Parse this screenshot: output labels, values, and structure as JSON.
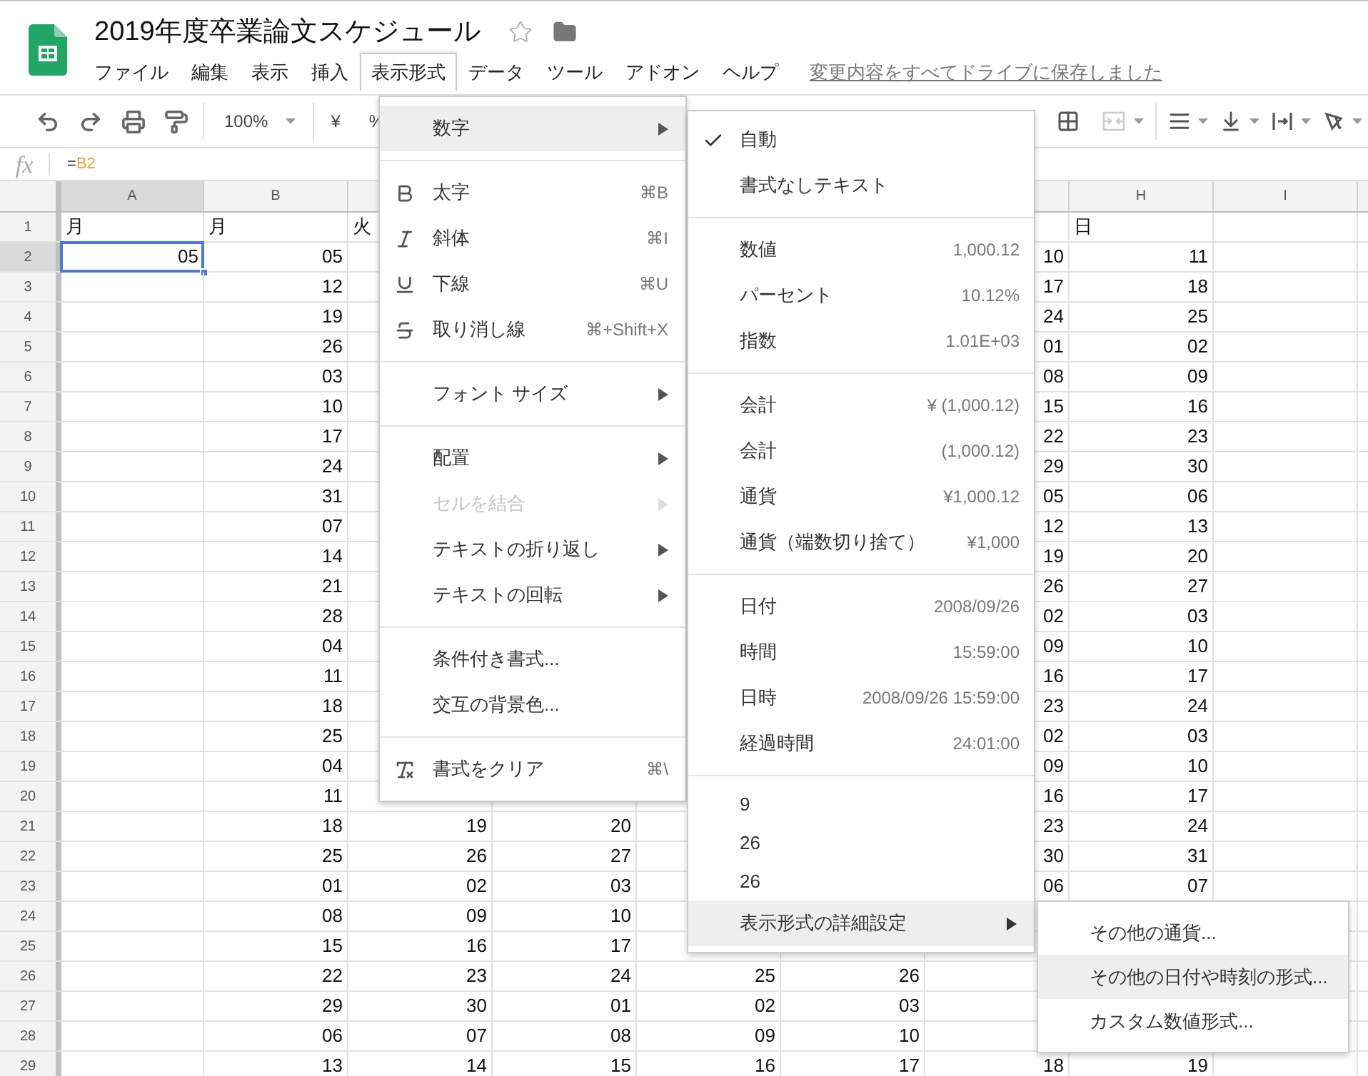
{
  "title": "2019年度卒業論文スケジュール",
  "menubar": [
    {
      "label": "ファイル",
      "selected": false
    },
    {
      "label": "編集",
      "selected": false
    },
    {
      "label": "表示",
      "selected": false
    },
    {
      "label": "挿入",
      "selected": false
    },
    {
      "label": "表示形式",
      "selected": true
    },
    {
      "label": "データ",
      "selected": false
    },
    {
      "label": "ツール",
      "selected": false
    },
    {
      "label": "アドオン",
      "selected": false
    },
    {
      "label": "ヘルプ",
      "selected": false
    }
  ],
  "save_status": "変更内容をすべてドライブに保存しました",
  "toolbar": {
    "zoom": "100%",
    "currency": "¥",
    "percent": "%"
  },
  "formula": {
    "label": "fx",
    "sign": "=",
    "reference": "B2"
  },
  "columns": [
    {
      "label": "A",
      "selected": true
    },
    {
      "label": "B",
      "selected": false
    },
    null,
    null,
    null,
    null,
    null,
    {
      "label": "H",
      "selected": false
    },
    {
      "label": "I",
      "selected": false
    }
  ],
  "rows": [
    {
      "number": "1",
      "selected": false,
      "kind": "text",
      "cells": [
        "月",
        "月",
        "火",
        null,
        null,
        null,
        null,
        "日",
        null
      ]
    },
    {
      "number": "2",
      "selected": true,
      "kind": "number",
      "cells": [
        "05",
        "05",
        null,
        null,
        null,
        null,
        "10",
        "11",
        null
      ]
    },
    {
      "number": "3",
      "selected": false,
      "kind": "number",
      "cells": [
        null,
        "12",
        null,
        null,
        null,
        null,
        "17",
        "18",
        null
      ]
    },
    {
      "number": "4",
      "selected": false,
      "kind": "number",
      "cells": [
        null,
        "19",
        null,
        null,
        null,
        null,
        "24",
        "25",
        null
      ]
    },
    {
      "number": "5",
      "selected": false,
      "kind": "number",
      "cells": [
        null,
        "26",
        null,
        null,
        null,
        null,
        "01",
        "02",
        null
      ]
    },
    {
      "number": "6",
      "selected": false,
      "kind": "number",
      "cells": [
        null,
        "03",
        null,
        null,
        null,
        null,
        "08",
        "09",
        null
      ]
    },
    {
      "number": "7",
      "selected": false,
      "kind": "number",
      "cells": [
        null,
        "10",
        null,
        null,
        null,
        null,
        "15",
        "16",
        null
      ]
    },
    {
      "number": "8",
      "selected": false,
      "kind": "number",
      "cells": [
        null,
        "17",
        null,
        null,
        null,
        null,
        "22",
        "23",
        null
      ]
    },
    {
      "number": "9",
      "selected": false,
      "kind": "number",
      "cells": [
        null,
        "24",
        null,
        null,
        null,
        null,
        "29",
        "30",
        null
      ]
    },
    {
      "number": "10",
      "selected": false,
      "kind": "number",
      "cells": [
        null,
        "31",
        null,
        null,
        null,
        null,
        "05",
        "06",
        null
      ]
    },
    {
      "number": "11",
      "selected": false,
      "kind": "number",
      "cells": [
        null,
        "07",
        null,
        null,
        null,
        null,
        "12",
        "13",
        null
      ]
    },
    {
      "number": "12",
      "selected": false,
      "kind": "number",
      "cells": [
        null,
        "14",
        null,
        null,
        null,
        null,
        "19",
        "20",
        null
      ]
    },
    {
      "number": "13",
      "selected": false,
      "kind": "number",
      "cells": [
        null,
        "21",
        null,
        null,
        null,
        null,
        "26",
        "27",
        null
      ]
    },
    {
      "number": "14",
      "selected": false,
      "kind": "number",
      "cells": [
        null,
        "28",
        null,
        null,
        null,
        null,
        "02",
        "03",
        null
      ]
    },
    {
      "number": "15",
      "selected": false,
      "kind": "number",
      "cells": [
        null,
        "04",
        null,
        null,
        null,
        null,
        "09",
        "10",
        null
      ]
    },
    {
      "number": "16",
      "selected": false,
      "kind": "number",
      "cells": [
        null,
        "11",
        null,
        null,
        null,
        null,
        "16",
        "17",
        null
      ]
    },
    {
      "number": "17",
      "selected": false,
      "kind": "number",
      "cells": [
        null,
        "18",
        null,
        null,
        null,
        null,
        "23",
        "24",
        null
      ]
    },
    {
      "number": "18",
      "selected": false,
      "kind": "number",
      "cells": [
        null,
        "25",
        null,
        null,
        null,
        null,
        "02",
        "03",
        null
      ]
    },
    {
      "number": "19",
      "selected": false,
      "kind": "number",
      "cells": [
        null,
        "04",
        null,
        null,
        null,
        null,
        "09",
        "10",
        null
      ]
    },
    {
      "number": "20",
      "selected": false,
      "kind": "number",
      "cells": [
        null,
        "11",
        null,
        null,
        null,
        null,
        "16",
        "17",
        null
      ]
    },
    {
      "number": "21",
      "selected": false,
      "kind": "number",
      "cells": [
        null,
        "18",
        "19",
        "20",
        null,
        null,
        "23",
        "24",
        null
      ]
    },
    {
      "number": "22",
      "selected": false,
      "kind": "number",
      "cells": [
        null,
        "25",
        "26",
        "27",
        null,
        null,
        "30",
        "31",
        null
      ]
    },
    {
      "number": "23",
      "selected": false,
      "kind": "number",
      "cells": [
        null,
        "01",
        "02",
        "03",
        null,
        null,
        "06",
        "07",
        null
      ]
    },
    {
      "number": "24",
      "selected": false,
      "kind": "number",
      "cells": [
        null,
        "08",
        "09",
        "10",
        null,
        null,
        null,
        null,
        null
      ]
    },
    {
      "number": "25",
      "selected": false,
      "kind": "number",
      "cells": [
        null,
        "15",
        "16",
        "17",
        null,
        null,
        null,
        null,
        null
      ]
    },
    {
      "number": "26",
      "selected": false,
      "kind": "number",
      "cells": [
        null,
        "22",
        "23",
        "24",
        "25",
        "26",
        null,
        null,
        null
      ]
    },
    {
      "number": "27",
      "selected": false,
      "kind": "number",
      "cells": [
        null,
        "29",
        "30",
        "01",
        "02",
        "03",
        null,
        null,
        null
      ]
    },
    {
      "number": "28",
      "selected": false,
      "kind": "number",
      "cells": [
        null,
        "06",
        "07",
        "08",
        "09",
        "10",
        null,
        null,
        null
      ]
    },
    {
      "number": "29",
      "selected": false,
      "kind": "number",
      "cells": [
        null,
        "13",
        "14",
        "15",
        "16",
        "17",
        "18",
        "19",
        null
      ]
    }
  ],
  "format_menu": [
    {
      "kind": "item",
      "label": "数字",
      "submenu": true,
      "highlighted": true,
      "disabled": false
    },
    {
      "kind": "separator"
    },
    {
      "kind": "bold",
      "label": "太字",
      "shortcut": "⌘B",
      "submenu": false,
      "highlighted": false,
      "disabled": false
    },
    {
      "kind": "italic",
      "label": "斜体",
      "shortcut": "⌘I",
      "submenu": false,
      "highlighted": false,
      "disabled": false
    },
    {
      "kind": "underline",
      "label": "下線",
      "shortcut": "⌘U",
      "submenu": false,
      "highlighted": false,
      "disabled": false
    },
    {
      "kind": "strikethrough",
      "label": "取り消し線",
      "shortcut": "⌘+Shift+X",
      "submenu": false,
      "highlighted": false,
      "disabled": false
    },
    {
      "kind": "separator"
    },
    {
      "kind": "item",
      "label": "フォント サイズ",
      "submenu": true,
      "highlighted": false,
      "disabled": false
    },
    {
      "kind": "separator"
    },
    {
      "kind": "item",
      "label": "配置",
      "submenu": true,
      "highlighted": false,
      "disabled": false
    },
    {
      "kind": "item",
      "label": "セルを結合",
      "submenu": true,
      "highlighted": false,
      "disabled": true
    },
    {
      "kind": "item",
      "label": "テキストの折り返し",
      "submenu": true,
      "highlighted": false,
      "disabled": false
    },
    {
      "kind": "item",
      "label": "テキストの回転",
      "submenu": true,
      "highlighted": false,
      "disabled": false
    },
    {
      "kind": "separator"
    },
    {
      "kind": "item",
      "label": "条件付き書式...",
      "submenu": false,
      "highlighted": false,
      "disabled": false
    },
    {
      "kind": "item",
      "label": "交互の背景色...",
      "submenu": false,
      "highlighted": false,
      "disabled": false
    },
    {
      "kind": "separator"
    },
    {
      "kind": "clear",
      "label": "書式をクリア",
      "shortcut": "⌘\\",
      "submenu": false,
      "highlighted": false,
      "disabled": false
    }
  ],
  "number_menu": [
    {
      "kind": "item",
      "label": "自動",
      "checked": true,
      "submenu": false,
      "highlighted": false
    },
    {
      "kind": "item",
      "label": "書式なしテキスト",
      "checked": false,
      "submenu": false,
      "highlighted": false
    },
    {
      "kind": "separator"
    },
    {
      "kind": "item",
      "label": "数値",
      "example": "1,000.12",
      "checked": false,
      "submenu": false,
      "highlighted": false
    },
    {
      "kind": "item",
      "label": "パーセント",
      "example": "10.12%",
      "checked": false,
      "submenu": false,
      "highlighted": false
    },
    {
      "kind": "item",
      "label": "指数",
      "example": "1.01E+03",
      "checked": false,
      "submenu": false,
      "highlighted": false
    },
    {
      "kind": "separator"
    },
    {
      "kind": "item",
      "label": "会計",
      "example": "¥ (1,000.12)",
      "checked": false,
      "submenu": false,
      "highlighted": false
    },
    {
      "kind": "item",
      "label": "会計",
      "example": "(1,000.12)",
      "checked": false,
      "submenu": false,
      "highlighted": false
    },
    {
      "kind": "item",
      "label": "通貨",
      "example": "¥1,000.12",
      "checked": false,
      "submenu": false,
      "highlighted": false
    },
    {
      "kind": "item",
      "label": "通貨（端数切り捨て）",
      "example": "¥1,000",
      "checked": false,
      "submenu": false,
      "highlighted": false
    },
    {
      "kind": "separator"
    },
    {
      "kind": "item",
      "label": "日付",
      "example": "2008/09/26",
      "checked": false,
      "submenu": false,
      "highlighted": false
    },
    {
      "kind": "item",
      "label": "時間",
      "example": "15:59:00",
      "checked": false,
      "submenu": false,
      "highlighted": false
    },
    {
      "kind": "item",
      "label": "日時",
      "example": "2008/09/26 15:59:00",
      "checked": false,
      "submenu": false,
      "highlighted": false
    },
    {
      "kind": "item",
      "label": "経過時間",
      "example": "24:01:00",
      "checked": false,
      "submenu": false,
      "highlighted": false
    },
    {
      "kind": "separator"
    },
    {
      "kind": "recent",
      "label": "9",
      "checked": false,
      "submenu": false,
      "highlighted": false
    },
    {
      "kind": "recent",
      "label": "26",
      "checked": false,
      "submenu": false,
      "highlighted": false
    },
    {
      "kind": "recent",
      "label": "26",
      "checked": false,
      "submenu": false,
      "highlighted": false
    },
    {
      "kind": "item",
      "label": "表示形式の詳細設定",
      "checked": false,
      "submenu": true,
      "highlighted": true
    }
  ],
  "advanced_menu": [
    {
      "label": "その他の通貨...",
      "highlighted": false
    },
    {
      "label": "その他の日付や時刻の形式...",
      "highlighted": true
    },
    {
      "label": "カスタム数値形式...",
      "highlighted": false
    }
  ]
}
